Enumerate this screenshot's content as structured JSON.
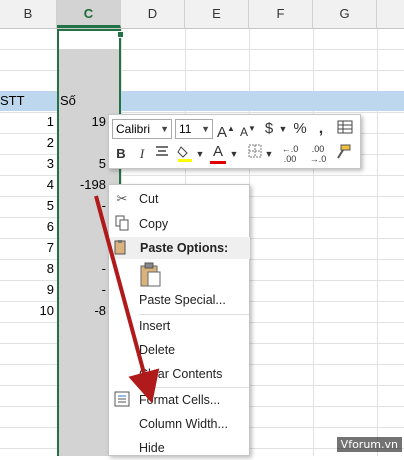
{
  "columns": [
    "B",
    "C",
    "D",
    "E",
    "F",
    "G"
  ],
  "header_row": {
    "stt": "STT",
    "so": "Số"
  },
  "rows": [
    {
      "stt": "1",
      "so": "19"
    },
    {
      "stt": "2",
      "so": ""
    },
    {
      "stt": "3",
      "so": "5"
    },
    {
      "stt": "4",
      "so": "-198"
    },
    {
      "stt": "5",
      "so": "-"
    },
    {
      "stt": "6",
      "so": ""
    },
    {
      "stt": "7",
      "so": ""
    },
    {
      "stt": "8",
      "so": "-"
    },
    {
      "stt": "9",
      "so": "-"
    },
    {
      "stt": "10",
      "so": "-8"
    }
  ],
  "mini_toolbar": {
    "font_name": "Calibri",
    "font_size": "11",
    "grow_font": "A",
    "shrink_font": "A",
    "currency": "$",
    "percent": "%",
    "comma": ",",
    "bold": "B",
    "italic": "I",
    "font_color_glyph": "A",
    "inc_decimal": ".00",
    "dec_decimal": ".00"
  },
  "context_menu": {
    "cut": "Cut",
    "copy": "Copy",
    "paste_options": "Paste Options:",
    "paste_special": "Paste Special...",
    "insert": "Insert",
    "delete": "Delete",
    "clear_contents": "Clear Contents",
    "format_cells": "Format Cells...",
    "column_width": "Column Width...",
    "hide": "Hide"
  },
  "watermark": "Vforum.vn",
  "colors": {
    "accent_green": "#217346",
    "header_band": "#bdd7ee",
    "selection_gray": "#d3d3d3",
    "arrow_red": "#b11a1a",
    "font_color_red": "#e00000"
  }
}
